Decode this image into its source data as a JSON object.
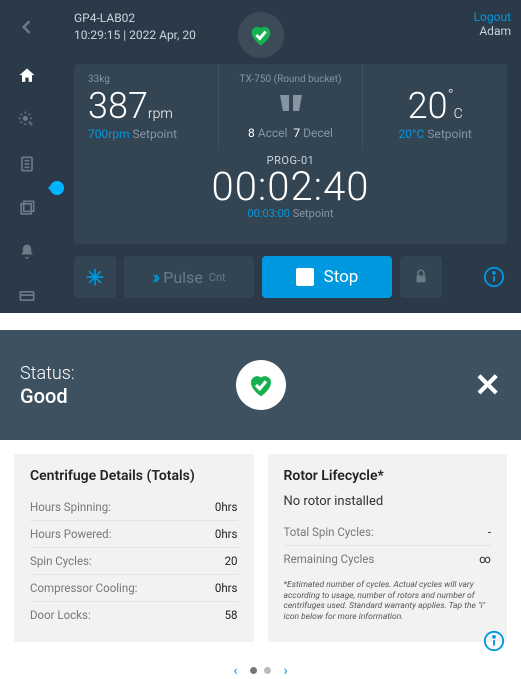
{
  "header": {
    "device_id": "GP4-LAB02",
    "timestamp": "10:29:15 | 2022 Apr, 20",
    "logout_label": "Logout",
    "user": "Adam"
  },
  "stats": {
    "speed": {
      "mass": "33kg",
      "value": "387",
      "unit": "rpm",
      "setpoint_val": "700rpm",
      "setpoint_lbl": "Setpoint"
    },
    "rotor": {
      "name": "TX-750 (Round bucket)",
      "accel_n": "8",
      "accel_lbl": "Accel",
      "decel_n": "7",
      "decel_lbl": "Decel"
    },
    "temp": {
      "value": "20",
      "unit": "C",
      "setpoint_val": "20°C",
      "setpoint_lbl": "Setpoint"
    }
  },
  "program": {
    "label": "PROG-01",
    "timer": "00:02:40",
    "set_val": "00:03:00",
    "set_lbl": "Setpoint"
  },
  "controls": {
    "pulse_label": "Pulse",
    "pulse_cnt": "Cnt",
    "stop_label": "Stop"
  },
  "status_panel": {
    "label": "Status:",
    "value": "Good"
  },
  "centrifuge_card": {
    "title": "Centrifuge Details (Totals)",
    "rows": [
      {
        "k": "Hours Spinning:",
        "v": "0hrs"
      },
      {
        "k": "Hours Powered:",
        "v": "0hrs"
      },
      {
        "k": "Spin Cycles:",
        "v": "20"
      },
      {
        "k": "Compressor Cooling:",
        "v": "0hrs"
      },
      {
        "k": "Door Locks:",
        "v": "58"
      }
    ]
  },
  "rotor_card": {
    "title": "Rotor Lifecycle*",
    "message": "No rotor installed",
    "rows": [
      {
        "k": "Total Spin Cycles:",
        "v": "-"
      },
      {
        "k": "Remaining Cycles",
        "v": "∞"
      }
    ],
    "disclaimer": "*Estimated number of cycles. Actual cycles will vary according to usage, number of rotors and number of centrifuges used. Standard warranty applies. Tap the \"i\" icon below for more information."
  }
}
